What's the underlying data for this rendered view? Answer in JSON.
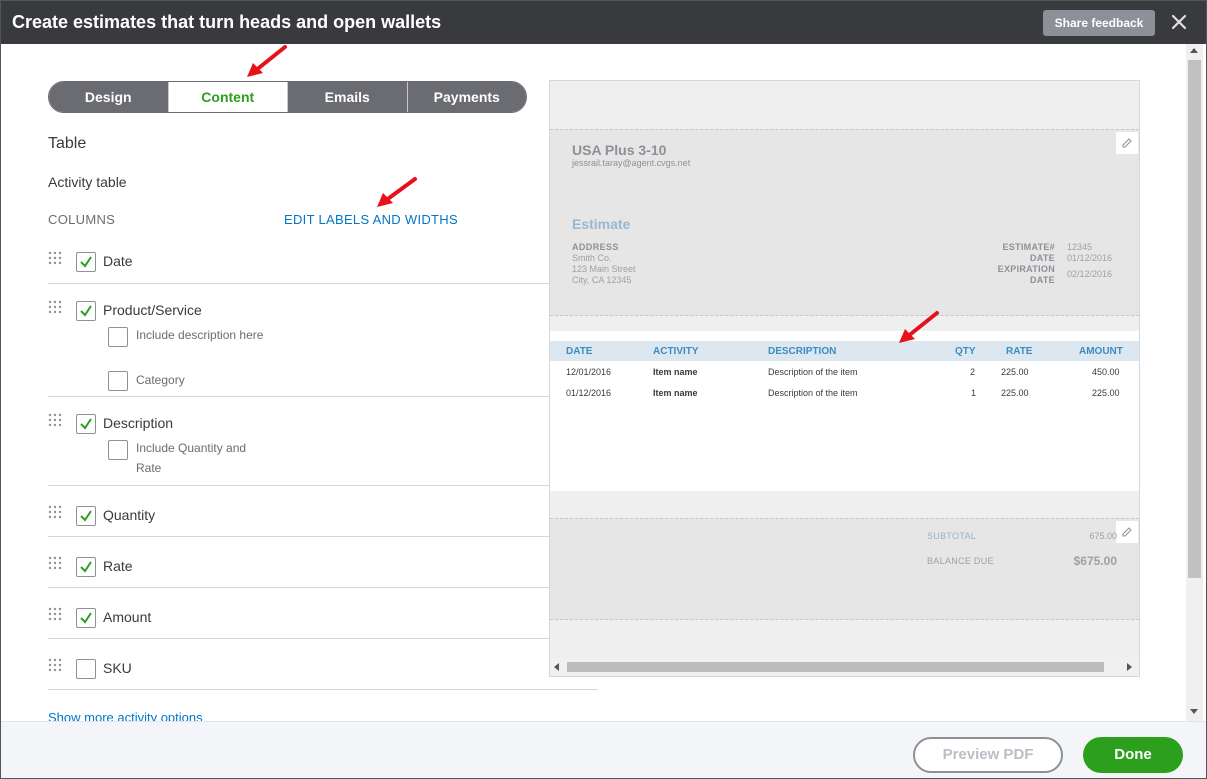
{
  "window": {
    "title": "Create estimates that turn heads and open wallets",
    "share_feedback": "Share feedback",
    "close_icon": "close-icon"
  },
  "tabs": [
    {
      "label": "Design",
      "active": false
    },
    {
      "label": "Content",
      "active": true
    },
    {
      "label": "Emails",
      "active": false
    },
    {
      "label": "Payments",
      "active": false
    }
  ],
  "settings": {
    "section_title": "Table",
    "subsection_title": "Activity table",
    "columns_label": "COLUMNS",
    "edit_link": "EDIT LABELS AND WIDTHS",
    "show_more_link": "Show more activity options",
    "columns": [
      {
        "label": "Date",
        "checked": true
      },
      {
        "label": "Product/Service",
        "checked": true,
        "options": [
          {
            "label": "Include description here",
            "checked": false
          },
          {
            "label": "Category",
            "checked": false
          }
        ]
      },
      {
        "label": "Description",
        "checked": true,
        "options": [
          {
            "label": "Include Quantity and Rate",
            "checked": false
          }
        ]
      },
      {
        "label": "Quantity",
        "checked": true
      },
      {
        "label": "Rate",
        "checked": true
      },
      {
        "label": "Amount",
        "checked": true
      },
      {
        "label": "SKU",
        "checked": false
      }
    ]
  },
  "preview": {
    "company": "USA Plus 3-10",
    "email": "jessrail.taray@agent.cvgs.net",
    "doc_title": "Estimate",
    "address_label": "ADDRESS",
    "address_lines": [
      "Smith Co.",
      "123 Main Street",
      "City, CA 12345"
    ],
    "estimate_no_label": "ESTIMATE#",
    "estimate_no": "12345",
    "date_label": "DATE",
    "date": "01/12/2016",
    "expiration_label_1": "EXPIRATION",
    "expiration_label_2": "DATE",
    "expiration": "02/12/2016",
    "table_headers": [
      "DATE",
      "ACTIVITY",
      "DESCRIPTION",
      "QTY",
      "RATE",
      "AMOUNT"
    ],
    "table_rows": [
      [
        "12/01/2016",
        "Item name",
        "Description of the item",
        "2",
        "225.00",
        "450.00"
      ],
      [
        "01/12/2016",
        "Item name",
        "Description of the item",
        "1",
        "225.00",
        "225.00"
      ]
    ],
    "subtotal_label": "SUBTOTAL",
    "subtotal": "675.00",
    "balance_label": "BALANCE DUE",
    "balance": "$675.00"
  },
  "footer": {
    "preview_pdf": "Preview PDF",
    "done": "Done"
  },
  "colors": {
    "accent_green": "#2ca01c",
    "link_blue": "#0077c5",
    "header_dark": "#393a3d",
    "annotation_red": "#e8101a"
  }
}
